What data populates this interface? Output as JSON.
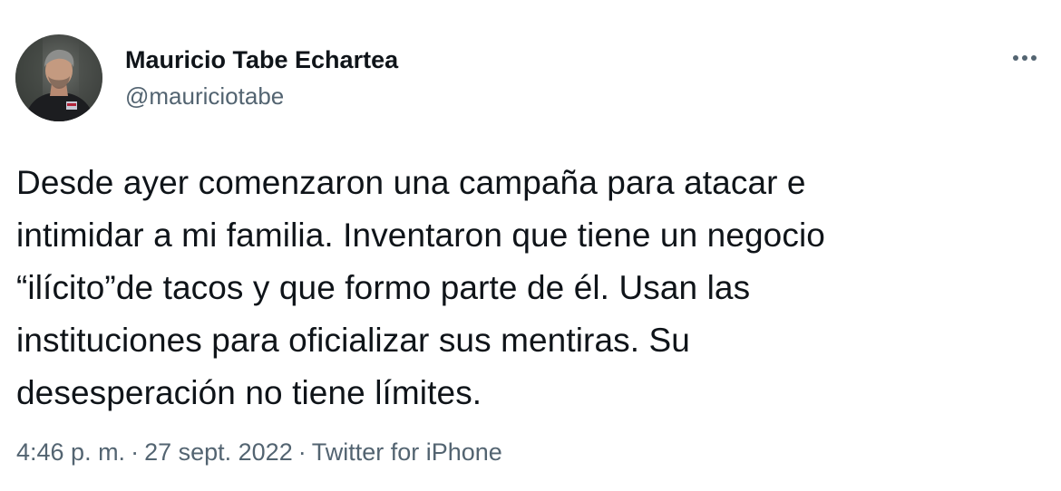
{
  "author": {
    "name": "Mauricio Tabe Echartea",
    "handle": "@mauriciotabe"
  },
  "menu": {
    "icon": "more-horizontal-icon"
  },
  "tweet": {
    "lines": [
      "Desde ayer comenzaron una campaña para atacar e",
      "intimidar a mi familia. Inventaron que tiene un negocio",
      "“ilícito”de tacos y que formo parte de él. Usan las",
      "instituciones para oficializar sus mentiras. Su",
      "desesperación no tiene límites."
    ]
  },
  "meta": {
    "time": "4:46 p. m.",
    "separator": "·",
    "date": "27 sept. 2022",
    "source": "Twitter for iPhone"
  },
  "colors": {
    "text": "#0f1419",
    "secondary": "#536471",
    "background": "#ffffff"
  }
}
